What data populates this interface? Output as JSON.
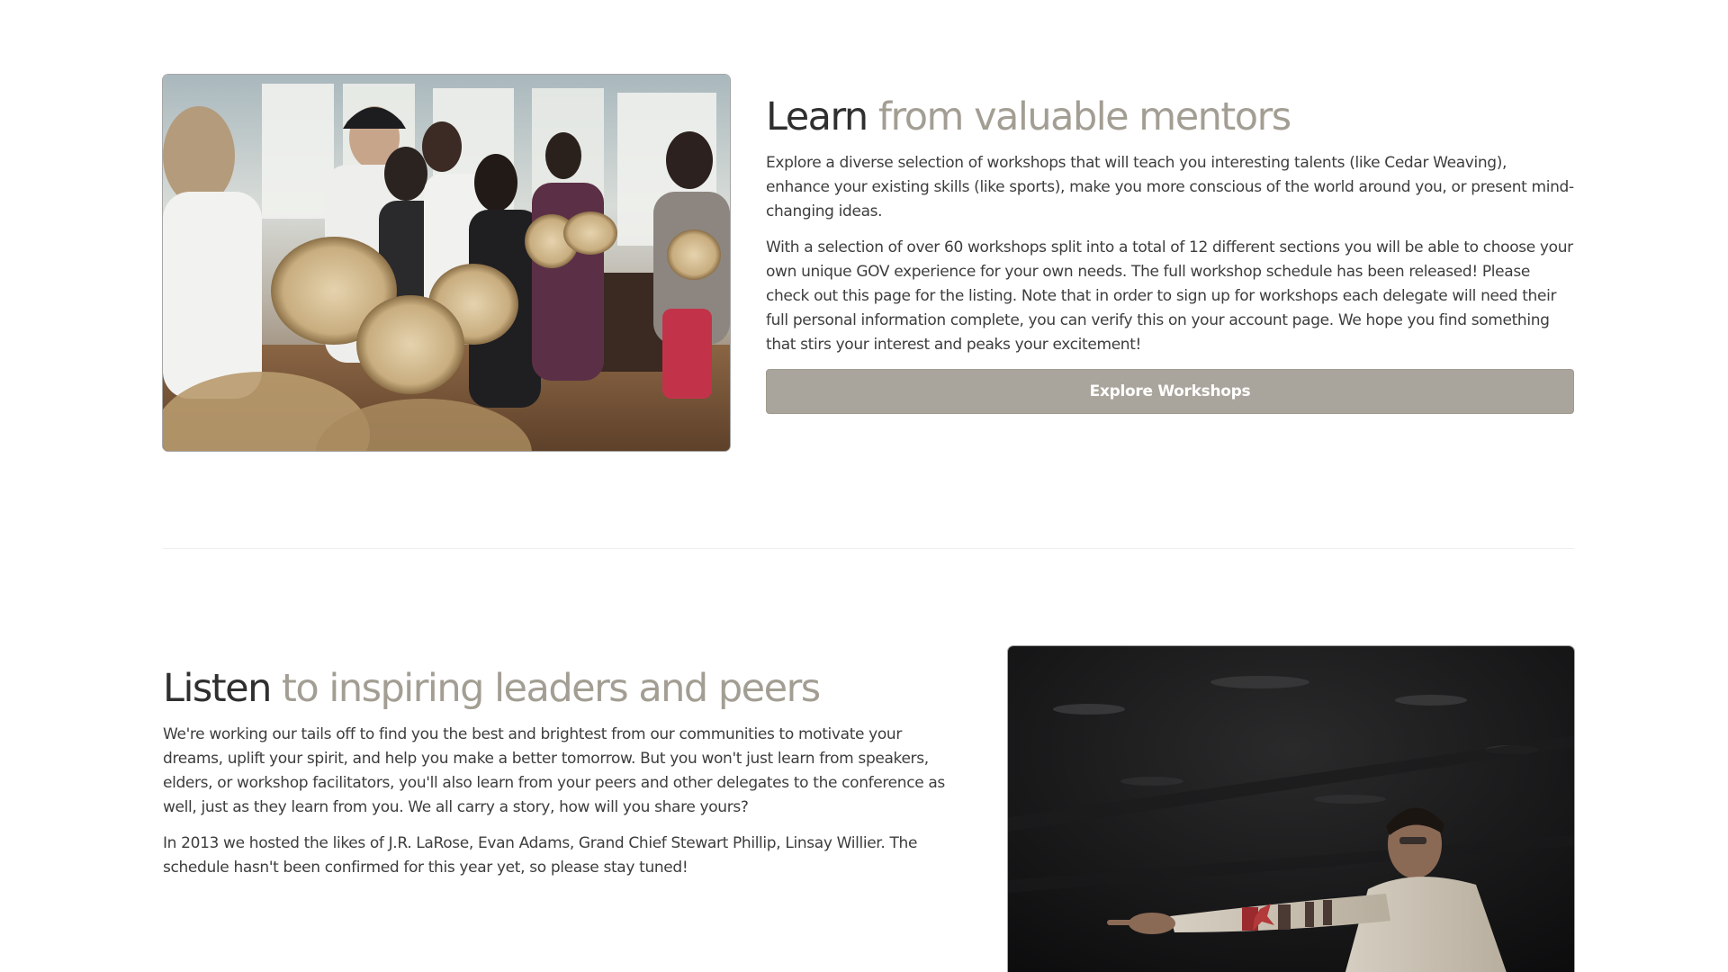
{
  "mentors": {
    "heading_strong": "Learn",
    "heading_light": "from valuable mentors",
    "paragraphs": [
      "Explore a diverse selection of workshops that will teach you interesting talents (like Cedar Weaving), enhance your existing skills (like sports), make you more conscious of the world around you, or present mind-changing ideas.",
      "With a selection of over 60 workshops split into a total of 12 different sections you will be able to choose your own unique GOV experience for your own needs. The full workshop schedule has been released! Please check out this page for the listing. Note that in order to sign up for workshops each delegate will need their full personal information complete, you can verify this on your account page. We hope you find something that stirs your interest and peaks your excitement!"
    ],
    "button_label": "Explore Workshops"
  },
  "leaders": {
    "heading_strong": "Listen",
    "heading_light": "to inspiring leaders and peers",
    "paragraphs": [
      "We're working our tails off to find you the best and brightest from our communities to motivate your dreams, uplift your spirit, and help you make a better tomorrow. But you won't just learn from speakers, elders, or workshop facilitators, you'll also learn from your peers and other delegates to the conference as well, just as they learn from you. We all carry a story, how will you share yours?",
      "In 2013 we hosted the likes of J.R. LaRose, Evan Adams, Grand Chief Stewart Phillip, Linsay Willier. The schedule hasn't been confirmed for this year yet, so please stay tuned!"
    ]
  },
  "colors": {
    "heading_dark": "#2f2f2f",
    "heading_light": "#a39e93",
    "button_bg": "#aaa59c",
    "button_text": "#ffffff",
    "body_text": "#3d3d3d"
  },
  "images": {
    "drum_photo": "drum-circle-photo",
    "speaker_photo": "speaker-pointing-photo"
  }
}
